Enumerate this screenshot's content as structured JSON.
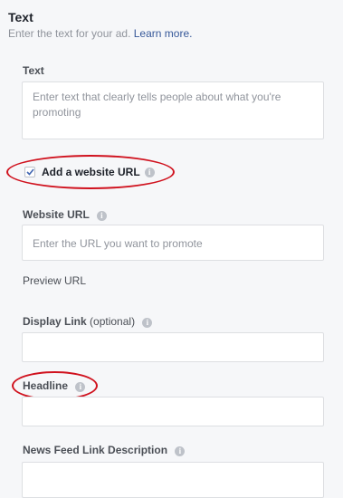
{
  "section": {
    "title": "Text",
    "subtitle": "Enter the text for your ad.",
    "learn_more": "Learn more."
  },
  "fields": {
    "text": {
      "label": "Text",
      "placeholder": "Enter text that clearly tells people about what you're promoting"
    },
    "add_website": {
      "label": "Add a website URL",
      "checked": true
    },
    "website_url": {
      "label": "Website URL",
      "placeholder": "Enter the URL you want to promote"
    },
    "preview_url": "Preview URL",
    "display_link": {
      "label": "Display Link",
      "optional": "(optional)"
    },
    "headline": {
      "label": "Headline"
    },
    "news_feed_desc": {
      "label": "News Feed Link Description"
    }
  },
  "icons": {
    "info": "i"
  },
  "colors": {
    "accent_link": "#365899",
    "annotation": "#d0121e",
    "checkmark": "#4267b2"
  }
}
